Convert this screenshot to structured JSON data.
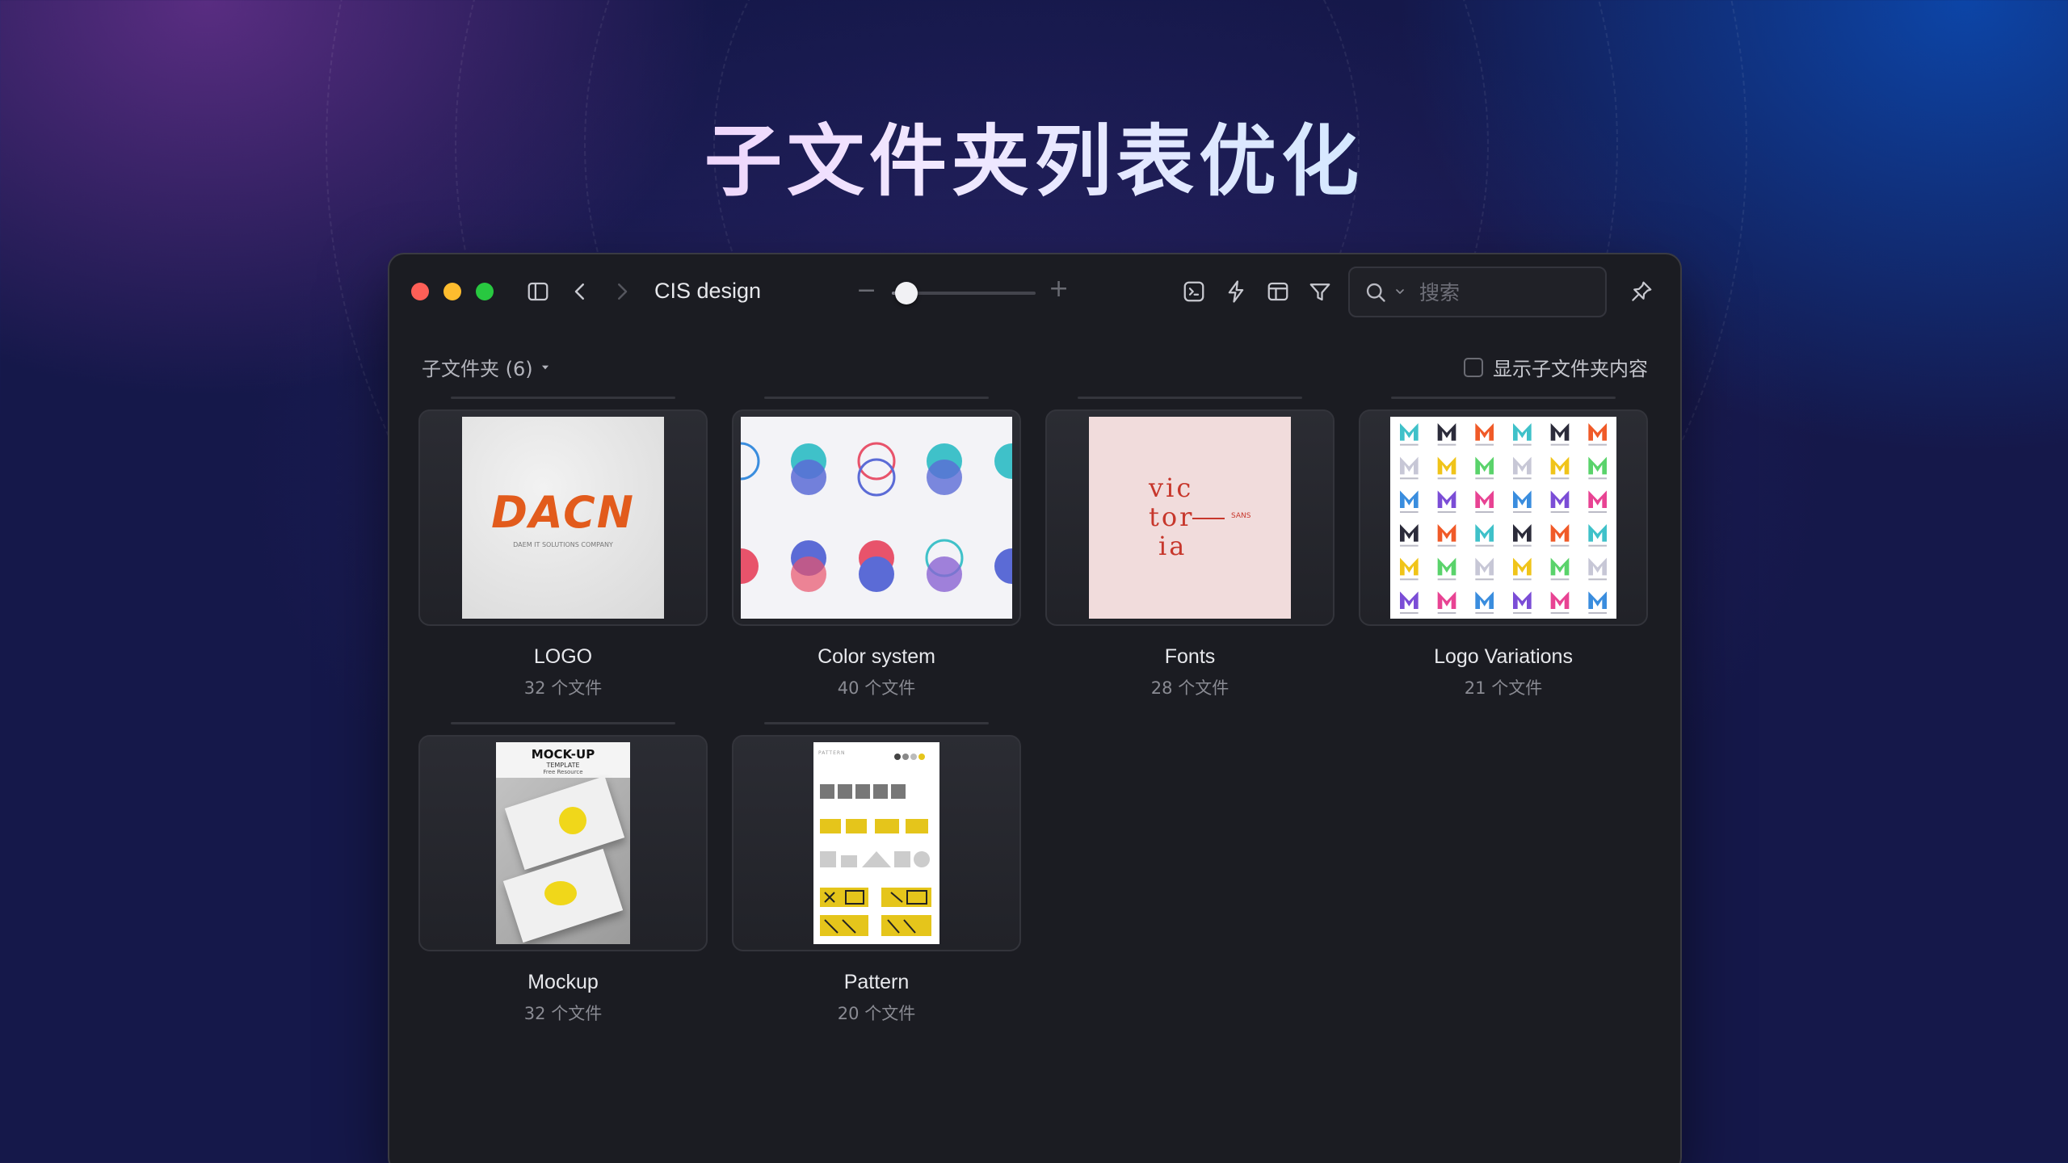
{
  "hero": {
    "title": "子文件夹列表优化"
  },
  "window": {
    "folder_title": "CIS design",
    "zoom_value": 0.1,
    "search": {
      "placeholder": "搜索",
      "value": ""
    }
  },
  "subfolders": {
    "toggle_label": "子文件夹 (6)",
    "show_content_label": "显示子文件夹内容",
    "show_content_checked": false,
    "items": [
      {
        "name": "LOGO",
        "count": "32 个文件",
        "logo_text": "DACN",
        "logo_caption": "DAEM IT SOLUTIONS COMPANY"
      },
      {
        "name": "Color system",
        "count": "40 个文件"
      },
      {
        "name": "Fonts",
        "count": "28 个文件",
        "line1": "vic",
        "line2": "tor",
        "line3": "ia",
        "aside": "SANS"
      },
      {
        "name": "Logo Variations",
        "count": "21 个文件"
      },
      {
        "name": "Mockup",
        "count": "32 个文件",
        "mock_title": "MOCK-UP",
        "mock_sub": "TEMPLATE",
        "mock_by": "Free Resource"
      },
      {
        "name": "Pattern",
        "count": "20 个文件",
        "pattern_header": "PATTERN"
      }
    ]
  },
  "colors": {
    "bg_purple": "#703494",
    "bg_blue": "#0a50be",
    "window_bg": "#1b1c22",
    "logo_orange": "#e25b1c",
    "fonts_red": "#c7372c",
    "pattern_yellow": "#e5c51b",
    "color_system": [
      "#3fc1c9",
      "#5b6bd6",
      "#e8536b",
      "#3a8dde",
      "#8a63d2"
    ],
    "variation_palette": [
      "#3fc1c9",
      "#f0c419",
      "#e84393",
      "#2b2b3a",
      "#5ad36b",
      "#3a8dde",
      "#f05a28",
      "#c7c7d6",
      "#7b4dd6"
    ]
  }
}
